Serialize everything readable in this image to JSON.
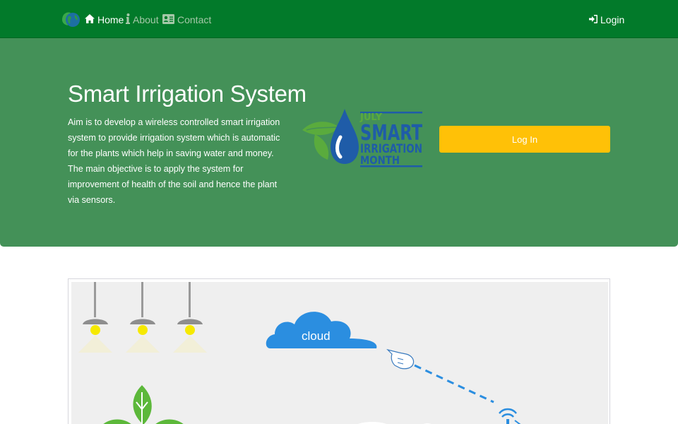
{
  "nav": {
    "brand_icon": "globe-leaf-logo",
    "home_label": "Home",
    "about_label": "About",
    "contact_label": "Contact",
    "login_label": "Login",
    "icons": {
      "home": "home-icon",
      "about": "info-icon",
      "contact": "contact-card-icon",
      "login": "sign-in-icon"
    }
  },
  "hero": {
    "title": "Smart Irrigation System",
    "description": "Aim is to develop a wireless controlled smart irrigation system to provide irrigation system which is automatic for the plants which help in saving water and money. The main objective is to apply the system for improvement of health of the soil and hence the plant via sensors.",
    "logo": {
      "line1": "JULY",
      "line2": "SMART",
      "line3": "IRRIGATION",
      "line4": "MONTH"
    },
    "button_label": "Log In"
  },
  "diagram": {
    "cloud_label": "cloud"
  },
  "colors": {
    "navbar": "#027a2a",
    "hero": "#449158",
    "button": "#ffc107",
    "logo_blue": "#1f5ca8",
    "logo_green": "#5aab3d",
    "cloud_blue": "#2b8ee0"
  }
}
